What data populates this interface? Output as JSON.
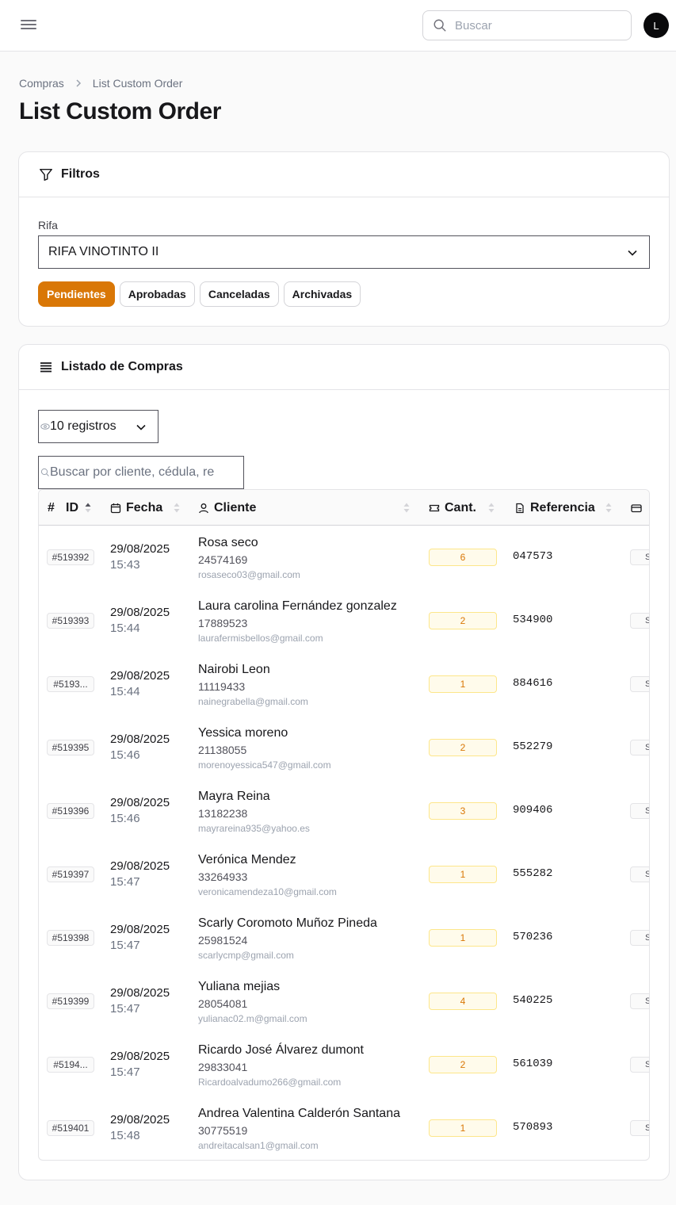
{
  "topbar": {
    "search_placeholder": "Buscar",
    "avatar_initial": "L"
  },
  "breadcrumb": {
    "parent": "Compras",
    "current": "List Custom Order"
  },
  "page_title": "List Custom Order",
  "filters": {
    "title": "Filtros",
    "rifa_label": "Rifa",
    "rifa_value": "RIFA VINOTINTO II",
    "status_tabs": [
      "Pendientes",
      "Aprobadas",
      "Canceladas",
      "Archivadas"
    ],
    "active_tab": "Pendientes"
  },
  "listing": {
    "title": "Listado de Compras",
    "per_page": "10 registros",
    "search_placeholder": "Buscar por cliente, cédula, re",
    "columns": [
      "#",
      "ID",
      "Fecha",
      "Cliente",
      "Cant.",
      "Referencia"
    ],
    "rows": [
      {
        "id": "#519392",
        "date": "29/08/2025",
        "time": "15:43",
        "name": "Rosa seco",
        "cedula": "24574169",
        "email": "rosaseco03@gmail.com",
        "qty": "6",
        "ref": "047573",
        "status": "S"
      },
      {
        "id": "#519393",
        "date": "29/08/2025",
        "time": "15:44",
        "name": "Laura carolina Fernández gonzalez",
        "cedula": "17889523",
        "email": "laurafermisbellos@gmail.com",
        "qty": "2",
        "ref": "534900",
        "status": "S"
      },
      {
        "id": "#5193...",
        "date": "29/08/2025",
        "time": "15:44",
        "name": "Nairobi Leon",
        "cedula": "11119433",
        "email": "nainegrabella@gmail.com",
        "qty": "1",
        "ref": "884616",
        "status": "S"
      },
      {
        "id": "#519395",
        "date": "29/08/2025",
        "time": "15:46",
        "name": "Yessica moreno",
        "cedula": "21138055",
        "email": "morenoyessica547@gmail.com",
        "qty": "2",
        "ref": "552279",
        "status": "S"
      },
      {
        "id": "#519396",
        "date": "29/08/2025",
        "time": "15:46",
        "name": "Mayra Reina",
        "cedula": "13182238",
        "email": "mayrareina935@yahoo.es",
        "qty": "3",
        "ref": "909406",
        "status": "S"
      },
      {
        "id": "#519397",
        "date": "29/08/2025",
        "time": "15:47",
        "name": "Verónica Mendez",
        "cedula": "33264933",
        "email": "veronicamendeza10@gmail.com",
        "qty": "1",
        "ref": "555282",
        "status": "S"
      },
      {
        "id": "#519398",
        "date": "29/08/2025",
        "time": "15:47",
        "name": "Scarly Coromoto Muñoz Pineda",
        "cedula": "25981524",
        "email": "scarlycmp@gmail.com",
        "qty": "1",
        "ref": "570236",
        "status": "S"
      },
      {
        "id": "#519399",
        "date": "29/08/2025",
        "time": "15:47",
        "name": "Yuliana mejias",
        "cedula": "28054081",
        "email": "yulianac02.m@gmail.com",
        "qty": "4",
        "ref": "540225",
        "status": "S"
      },
      {
        "id": "#5194...",
        "date": "29/08/2025",
        "time": "15:47",
        "name": "Ricardo José Álvarez dumont",
        "cedula": "29833041",
        "email": "Ricardoalvadumo266@gmail.com",
        "qty": "2",
        "ref": "561039",
        "status": "S"
      },
      {
        "id": "#519401",
        "date": "29/08/2025",
        "time": "15:48",
        "name": "Andrea Valentina Calderón Santana",
        "cedula": "30775519",
        "email": "andreitacalsan1@gmail.com",
        "qty": "1",
        "ref": "570893",
        "status": "S"
      }
    ]
  },
  "colors": {
    "accent": "#d97706",
    "qty_bg": "#fffbeb",
    "border": "#e4e4e7"
  },
  "icons": [
    "menu-icon",
    "search-icon",
    "chevron-right-icon",
    "filter-icon",
    "chevron-down-icon",
    "list-icon",
    "eye-icon",
    "calendar-icon",
    "user-icon",
    "ticket-icon",
    "document-icon",
    "card-icon",
    "sort-icon"
  ]
}
